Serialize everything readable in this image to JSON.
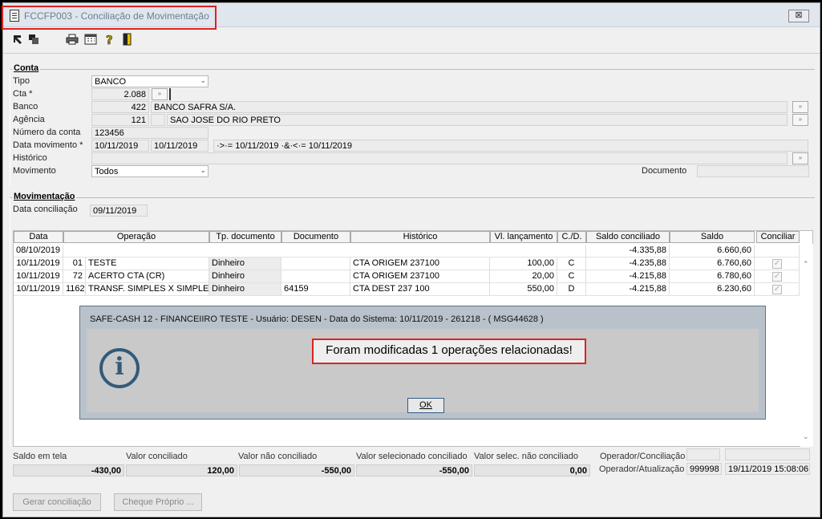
{
  "window": {
    "title": "FCCFP003 - Conciliação de Movimentação",
    "close_label": "⊠"
  },
  "conta": {
    "group_title": "Conta",
    "tipo_label": "Tipo",
    "tipo_value": "BANCO",
    "cta_label": "Cta *",
    "cta_value": "2.088",
    "banco_label": "Banco",
    "banco_code": "422",
    "banco_name": "BANCO SAFRA S/A.",
    "agencia_label": "Agência",
    "agencia_code": "121",
    "agencia_name": "SAO JOSE DO RIO PRETO",
    "numero_label": "Número da conta",
    "numero_value": "123456",
    "data_mov_label": "Data movimento *",
    "data_mov_from": "10/11/2019",
    "data_mov_to": "10/11/2019",
    "data_mov_filter": "·>·= 10/11/2019 ·&·<·= 10/11/2019",
    "historico_label": "Histórico",
    "movimento_label": "Movimento",
    "movimento_value": "Todos",
    "documento_label": "Documento"
  },
  "movimentacao": {
    "group_title": "Movimentação",
    "data_conc_label": "Data conciliação",
    "data_conc_value": "09/11/2019"
  },
  "grid": {
    "headers": [
      "Data",
      "Operação",
      "Tp. documento",
      "Documento",
      "Histórico",
      "Vl. lançamento",
      "C./D.",
      "Saldo conciliado",
      "Saldo",
      "Conciliar"
    ],
    "rows": [
      {
        "data": "08/10/2019",
        "op_num": "",
        "op_desc": "",
        "tp_doc": "",
        "documento": "",
        "historico": "",
        "valor": "",
        "cd": "",
        "saldo_conc": "-4.335,88",
        "saldo": "6.660,60",
        "check": false
      },
      {
        "data": "10/11/2019",
        "op_num": "01",
        "op_desc": "TESTE",
        "tp_doc": "Dinheiro",
        "documento": "",
        "historico": "CTA ORIGEM  237100",
        "valor": "100,00",
        "cd": "C",
        "saldo_conc": "-4.235,88",
        "saldo": "6.760,60",
        "check": true
      },
      {
        "data": "10/11/2019",
        "op_num": "72",
        "op_desc": "ACERTO CTA (CR)",
        "tp_doc": "Dinheiro",
        "documento": "",
        "historico": "CTA ORIGEM  237100",
        "valor": "20,00",
        "cd": "C",
        "saldo_conc": "-4.215,88",
        "saldo": "6.780,60",
        "check": true
      },
      {
        "data": "10/11/2019",
        "op_num": "1162",
        "op_desc": "TRANSF. SIMPLES X SIMPLES",
        "tp_doc": "Dinheiro",
        "documento": "64159",
        "historico": "CTA DEST  237 100",
        "valor": "550,00",
        "cd": "D",
        "saldo_conc": "-4.215,88",
        "saldo": "6.230,60",
        "check": true
      }
    ]
  },
  "footer": {
    "saldo_tela_label": "Saldo em tela",
    "saldo_tela_value": "-430,00",
    "valor_conc_label": "Valor conciliado",
    "valor_conc_value": "120,00",
    "valor_nao_conc_label": "Valor não conciliado",
    "valor_nao_conc_value": "-550,00",
    "valor_sel_conc_label": "Valor selecionado conciliado",
    "valor_sel_conc_value": "-550,00",
    "valor_sel_nao_conc_label": "Valor selec. não conciliado",
    "valor_sel_nao_conc_value": "0,00",
    "op_conc_label": "Operador/Conciliação",
    "op_conc_value": "",
    "op_atual_label": "Operador/Atualização",
    "op_atual_value": "999998",
    "op_atual_date": "19/11/2019 15:08:06"
  },
  "buttons": {
    "gerar": "Gerar conciliação",
    "cheque": "Cheque Próprio ..."
  },
  "modal": {
    "title": "SAFE-CASH 12 - FINANCEIIRO TESTE - Usuário: DESEN - Data do Sistema: 10/11/2019 - 261218 - ( MSG44628 )",
    "message": "Foram modificadas 1 operações relacionadas!",
    "ok_label": "OK",
    "icon": "info-icon"
  },
  "colors": {
    "highlight": "#dd2222",
    "modal_border": "#5e7383",
    "info_icon": "#345a78"
  }
}
